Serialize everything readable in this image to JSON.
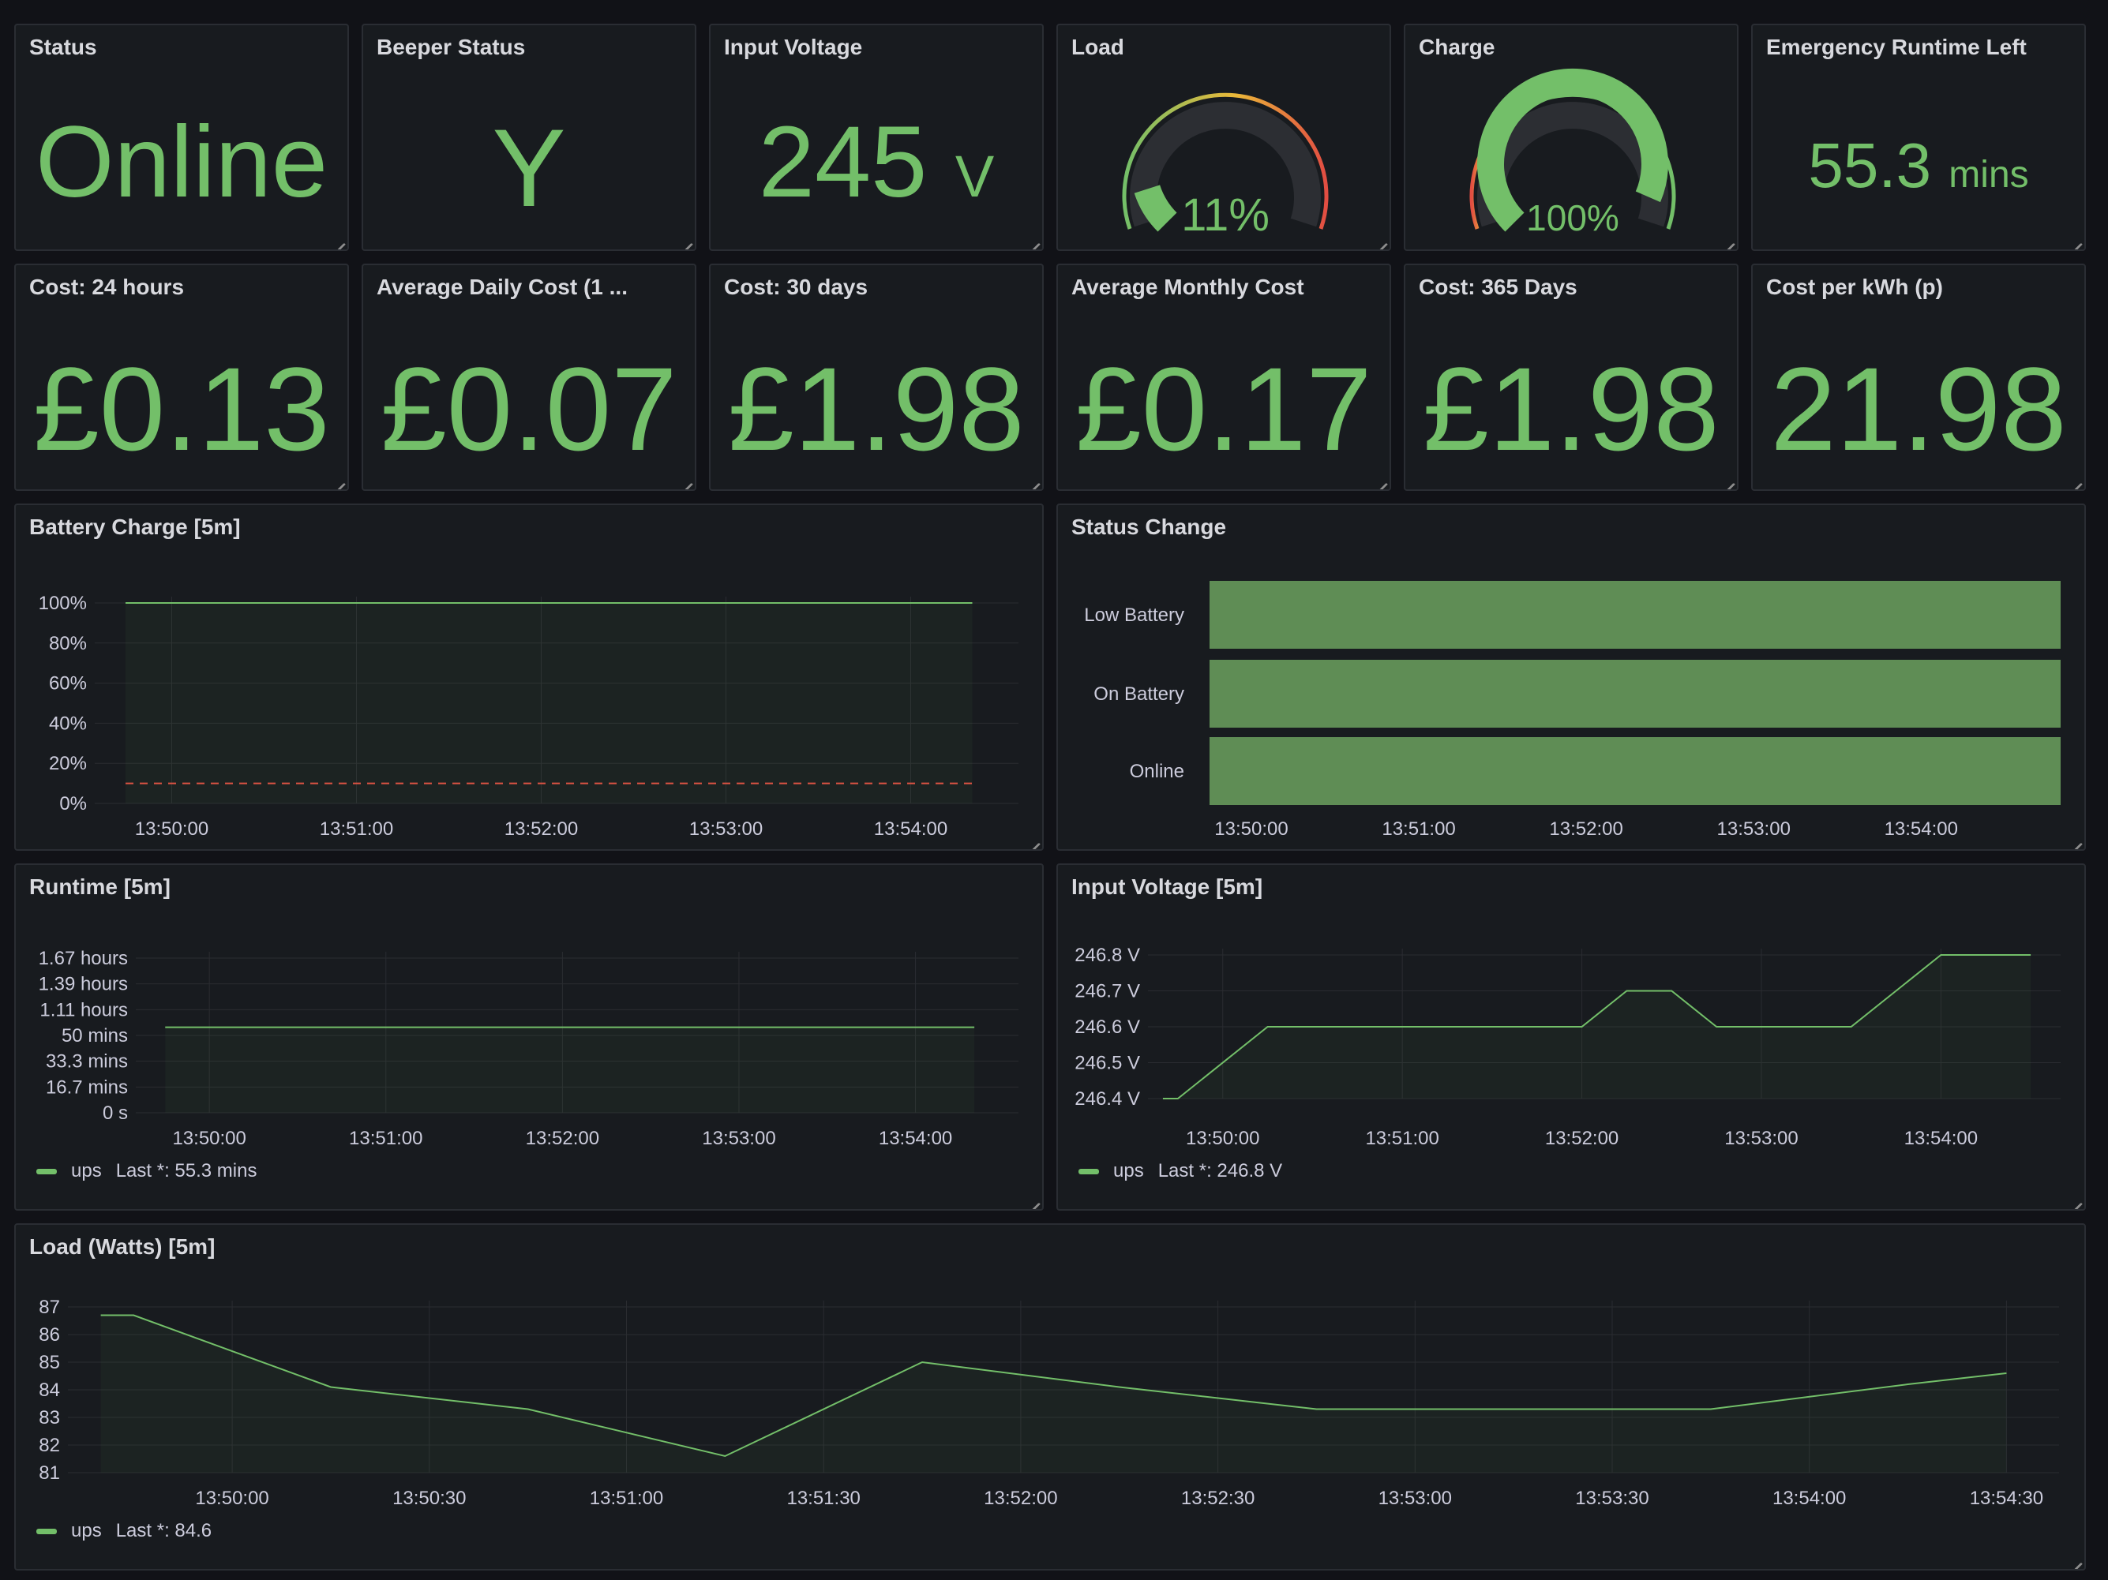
{
  "colors": {
    "background": "#111217",
    "panel": "#181b1f",
    "green": "#73bf69",
    "state_green": "#5f8d55",
    "threshold_red": "#e24d42",
    "gauge_yellow": "#eab839",
    "gauge_track": "#2c2e33"
  },
  "stats_row1": [
    {
      "title": "Status",
      "value": "Online",
      "unit": ""
    },
    {
      "title": "Beeper Status",
      "value": "Y",
      "unit": ""
    },
    {
      "title": "Input Voltage",
      "value": "245",
      "unit": "V"
    },
    {
      "title": "Emergency Runtime Left",
      "value": "55.3",
      "unit": "mins"
    }
  ],
  "gauges": [
    {
      "title": "Load",
      "value": "11%",
      "fraction": 0.11
    },
    {
      "title": "Charge",
      "value": "100%",
      "fraction": 1.0
    }
  ],
  "stats_row2": [
    {
      "title": "Cost: 24 hours",
      "value": "£0.13"
    },
    {
      "title": "Average Daily Cost (1 ...",
      "value": "£0.07"
    },
    {
      "title": "Cost: 30 days",
      "value": "£1.98"
    },
    {
      "title": "Average Monthly Cost",
      "value": "£0.17"
    },
    {
      "title": "Cost: 365 Days",
      "value": "£1.98"
    },
    {
      "title": "Cost per kWh (p)",
      "value": "21.98"
    }
  ],
  "battery_chart": {
    "title": "Battery Charge [5m]",
    "y_ticks": [
      "100%",
      "80%",
      "60%",
      "40%",
      "20%",
      "0%"
    ],
    "x_ticks": [
      "13:50:00",
      "13:51:00",
      "13:52:00",
      "13:53:00",
      "13:54:00"
    ]
  },
  "status_change": {
    "title": "Status Change",
    "rows": [
      "Low Battery",
      "On Battery",
      "Online"
    ],
    "x_ticks": [
      "13:50:00",
      "13:51:00",
      "13:52:00",
      "13:53:00",
      "13:54:00"
    ]
  },
  "runtime_chart": {
    "title": "Runtime [5m]",
    "y_ticks": [
      "1.67 hours",
      "1.39 hours",
      "1.11 hours",
      "50 mins",
      "33.3 mins",
      "16.7 mins",
      "0 s"
    ],
    "x_ticks": [
      "13:50:00",
      "13:51:00",
      "13:52:00",
      "13:53:00",
      "13:54:00"
    ],
    "legend_name": "ups",
    "legend_value": "Last *: 55.3 mins"
  },
  "voltage_chart": {
    "title": "Input Voltage [5m]",
    "y_ticks": [
      "246.8 V",
      "246.7 V",
      "246.6 V",
      "246.5 V",
      "246.4 V"
    ],
    "x_ticks": [
      "13:50:00",
      "13:51:00",
      "13:52:00",
      "13:53:00",
      "13:54:00"
    ],
    "legend_name": "ups",
    "legend_value": "Last *: 246.8 V"
  },
  "load_chart": {
    "title": "Load (Watts) [5m]",
    "y_ticks": [
      "87",
      "86",
      "85",
      "84",
      "83",
      "82",
      "81"
    ],
    "x_ticks": [
      "13:50:00",
      "13:50:30",
      "13:51:00",
      "13:51:30",
      "13:52:00",
      "13:52:30",
      "13:53:00",
      "13:53:30",
      "13:54:00",
      "13:54:30"
    ],
    "legend_name": "ups",
    "legend_value": "Last *: 84.6"
  },
  "chart_data": [
    {
      "type": "line",
      "title": "Battery Charge [5m]",
      "x": [
        "13:49:45",
        "13:54:20"
      ],
      "series": [
        {
          "values": [
            100,
            100
          ]
        }
      ],
      "threshold": 10,
      "ylim": [
        0,
        100
      ],
      "xlim": [
        "13:49:35",
        "13:54:35"
      ]
    },
    {
      "type": "table",
      "title": "Status Change",
      "categories": [
        "Low Battery",
        "On Battery",
        "Online"
      ],
      "xlim": [
        "13:49:45",
        "13:54:50"
      ]
    },
    {
      "type": "line",
      "title": "Runtime [5m]",
      "x": [
        "13:49:45",
        "13:54:20"
      ],
      "series": [
        {
          "name": "ups",
          "values": [
            55.3,
            55.3
          ]
        }
      ],
      "ylim": [
        0,
        100
      ],
      "yunit": "mins",
      "xlim": [
        "13:49:35",
        "13:54:35"
      ]
    },
    {
      "type": "line",
      "title": "Input Voltage [5m]",
      "x": [
        "13:49:40",
        "13:49:45",
        "13:50:15",
        "13:52:00",
        "13:52:15",
        "13:52:30",
        "13:52:45",
        "13:53:30",
        "13:54:00",
        "13:54:30"
      ],
      "series": [
        {
          "name": "ups",
          "values": [
            246.4,
            246.4,
            246.6,
            246.6,
            246.7,
            246.7,
            246.6,
            246.6,
            246.8,
            246.8
          ]
        }
      ],
      "ylim": [
        246.4,
        246.8
      ],
      "xlim": [
        "13:49:35",
        "13:54:40"
      ]
    },
    {
      "type": "line",
      "title": "Load (Watts) [5m]",
      "x": [
        "13:49:40",
        "13:49:45",
        "13:50:15",
        "13:50:45",
        "13:51:15",
        "13:51:45",
        "13:52:15",
        "13:52:45",
        "13:53:15",
        "13:53:45",
        "13:54:15",
        "13:54:30"
      ],
      "series": [
        {
          "name": "ups",
          "values": [
            86.7,
            86.7,
            84.1,
            83.3,
            81.6,
            85.0,
            84.1,
            83.3,
            83.3,
            83.3,
            84.2,
            84.6
          ]
        }
      ],
      "ylim": [
        81,
        87
      ],
      "xlim": [
        "13:49:35",
        "13:54:38"
      ]
    }
  ]
}
